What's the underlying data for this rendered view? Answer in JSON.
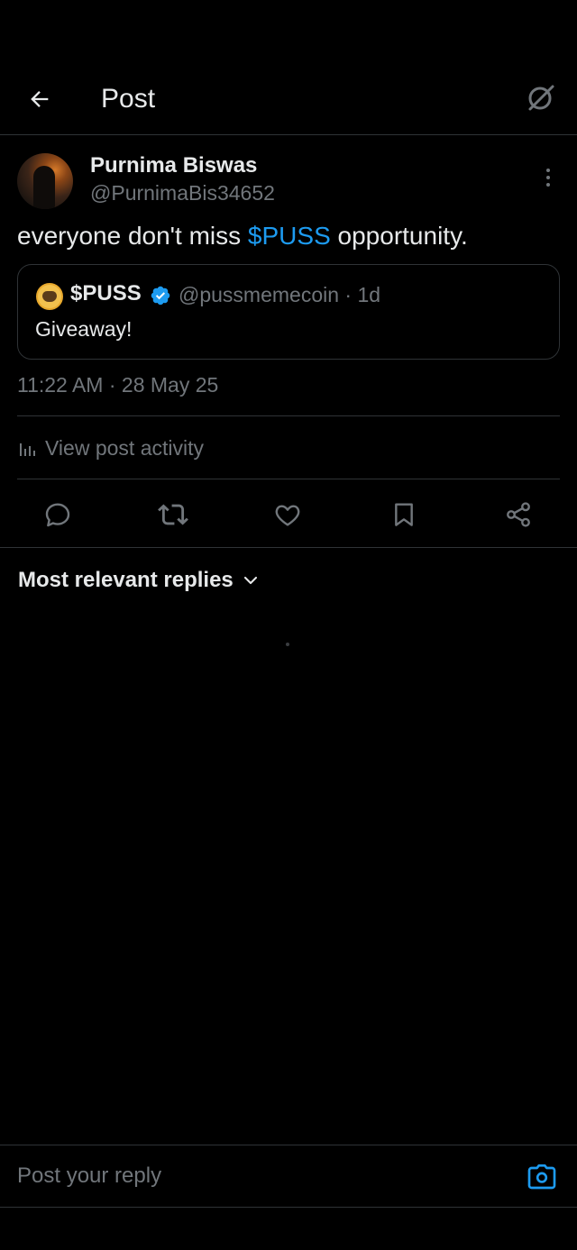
{
  "header": {
    "title": "Post",
    "back_icon": "arrow-left-icon",
    "grok_icon": "grok-icon"
  },
  "post": {
    "author_name": "Purnima Biswas",
    "author_handle": "@PurnimaBis34652",
    "text_before": "everyone don't miss ",
    "cashtag": "$PUSS",
    "text_after": " opportunity.",
    "timestamp": "11:22 AM · 28 May 25",
    "activity_label": "View post activity"
  },
  "quote": {
    "name": "$PUSS",
    "handle_time": "@pussmemecoin · 1d",
    "text": "Giveaway!"
  },
  "actions": [
    "reply-icon",
    "retweet-icon",
    "like-icon",
    "bookmark-icon",
    "share-icon"
  ],
  "replies": {
    "sort_label": "Most relevant replies"
  },
  "reply_bar": {
    "placeholder": "Post your reply"
  },
  "colors": {
    "accent": "#1d9bf0",
    "muted": "#71767b",
    "text": "#e7e9ea",
    "border": "#2f3336",
    "background": "#000000"
  }
}
